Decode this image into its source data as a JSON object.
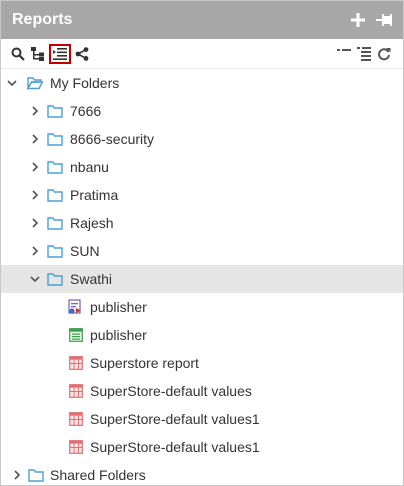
{
  "panel": {
    "title": "Reports",
    "header_icons": [
      "plus-icon",
      "pin-icon"
    ]
  },
  "toolbar": {
    "left_icons": [
      "search-icon",
      "tree-view-icon",
      "list-view-icon",
      "share-icon"
    ],
    "right_icons": [
      "collapse-icon",
      "expand-icon",
      "refresh-icon"
    ],
    "active": "list-view-icon"
  },
  "tree": {
    "root": {
      "label": "My Folders",
      "expanded": true
    },
    "folders": [
      {
        "label": "7666"
      },
      {
        "label": "8666-security"
      },
      {
        "label": "nbanu"
      },
      {
        "label": "Pratima"
      },
      {
        "label": "Rajesh"
      },
      {
        "label": "SUN"
      },
      {
        "label": "Swathi",
        "expanded": true,
        "selected": true
      }
    ],
    "swathi_items": [
      {
        "label": "publisher",
        "icon": "publisher-icon"
      },
      {
        "label": "publisher",
        "icon": "report-green-icon"
      },
      {
        "label": "Superstore report",
        "icon": "report-red-icon"
      },
      {
        "label": "SuperStore-default values",
        "icon": "report-red-icon"
      },
      {
        "label": "SuperStore-default values1",
        "icon": "report-red-icon"
      },
      {
        "label": "SuperStore-default values1",
        "icon": "report-red-icon"
      }
    ],
    "shared": {
      "label": "Shared Folders",
      "expanded": false
    }
  },
  "colors": {
    "header_bg": "#a8a8a8",
    "folder": "#4f9fd1",
    "selected_row": "#e6e6e6",
    "active_outline": "#c00000"
  }
}
